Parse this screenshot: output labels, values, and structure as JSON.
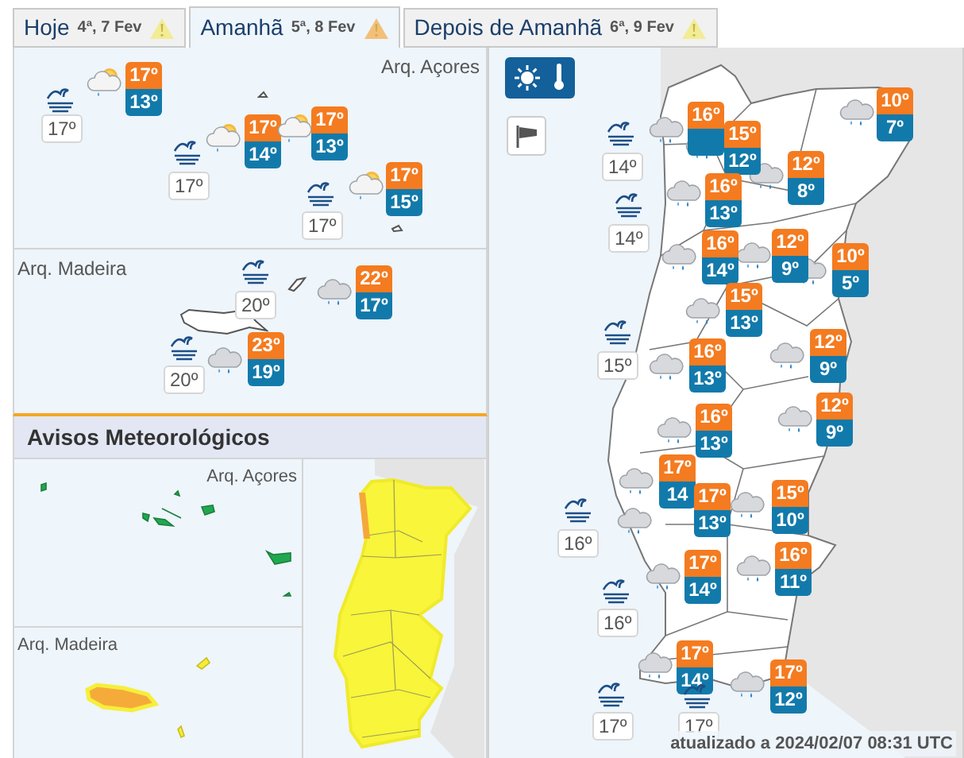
{
  "tabs": [
    {
      "label": "Hoje",
      "date": "4ª, 7 Fev",
      "selected": false,
      "color": "#f2ec94"
    },
    {
      "label": "Amanhã",
      "date": "5ª, 8 Fev",
      "selected": true,
      "color": "#f4bf79"
    },
    {
      "label": "Depois de Amanhã",
      "date": "6ª, 9 Fev",
      "selected": false,
      "color": "#f2ec94"
    }
  ],
  "islands": {
    "azores": {
      "label": "Arq. Açores",
      "forecasts": [
        {
          "kind": "sun-cloud",
          "max": "17º",
          "min": "13º"
        },
        {
          "kind": "sun-cloud",
          "max": "17º",
          "min": "14º"
        },
        {
          "kind": "sun-cloud",
          "max": "17º",
          "min": "13º"
        },
        {
          "kind": "sun-cloud",
          "max": "17º",
          "min": "15º"
        }
      ],
      "sea": [
        "17º",
        "17º",
        "17º"
      ]
    },
    "madeira": {
      "label": "Arq. Madeira",
      "forecasts": [
        {
          "kind": "rain",
          "max": "22º",
          "min": "17º"
        },
        {
          "kind": "rain",
          "max": "23º",
          "min": "19º"
        }
      ],
      "sea": [
        "20º",
        "20º"
      ]
    }
  },
  "avisos": {
    "title": "Avisos Meteorológicos",
    "azores_label": "Arq. Açores",
    "madeira_label": "Arq. Madeira"
  },
  "layers": [
    {
      "kind": "temperature",
      "selected": true
    },
    {
      "kind": "wind",
      "selected": false
    }
  ],
  "mainland": {
    "forecasts": [
      {
        "kind": "rain",
        "max": "16º"
      },
      {
        "kind": "rain",
        "max": "15º",
        "min": "12º"
      },
      {
        "kind": "rain",
        "max": "12º",
        "min": "8º"
      },
      {
        "kind": "rain",
        "max": "10º",
        "min": "7º"
      },
      {
        "kind": "rain",
        "max": "16º",
        "min": "13º"
      },
      {
        "kind": "rain",
        "max": "16º",
        "min": "14º"
      },
      {
        "kind": "rain",
        "max": "12º",
        "min": "9º"
      },
      {
        "kind": "rain",
        "max": "10º",
        "min": "5º"
      },
      {
        "kind": "rain",
        "max": "15º",
        "min": "13º"
      },
      {
        "kind": "rain",
        "max": "16º",
        "min": "13º"
      },
      {
        "kind": "rain",
        "max": "12º",
        "min": "9º"
      },
      {
        "kind": "rain",
        "max": "12º",
        "min": "9º"
      },
      {
        "kind": "rain",
        "max": "16º",
        "min": "13º"
      },
      {
        "kind": "rain",
        "max": "17º",
        "min": "14"
      },
      {
        "kind": "rain",
        "max": "17º",
        "min": "13º"
      },
      {
        "kind": "rain",
        "max": "15º",
        "min": "10º"
      },
      {
        "kind": "rain",
        "max": "16º",
        "min": "11º"
      },
      {
        "kind": "rain",
        "max": "17º",
        "min": "14º"
      },
      {
        "kind": "rain",
        "max": "17º",
        "min": "14º"
      },
      {
        "kind": "rain",
        "max": "17º",
        "min": "12º"
      }
    ],
    "sea": [
      "14º",
      "14º",
      "15º",
      "16º",
      "16º",
      "17º",
      "17º"
    ]
  },
  "updated": "atualizado a 2024/02/07 08:31 UTC"
}
